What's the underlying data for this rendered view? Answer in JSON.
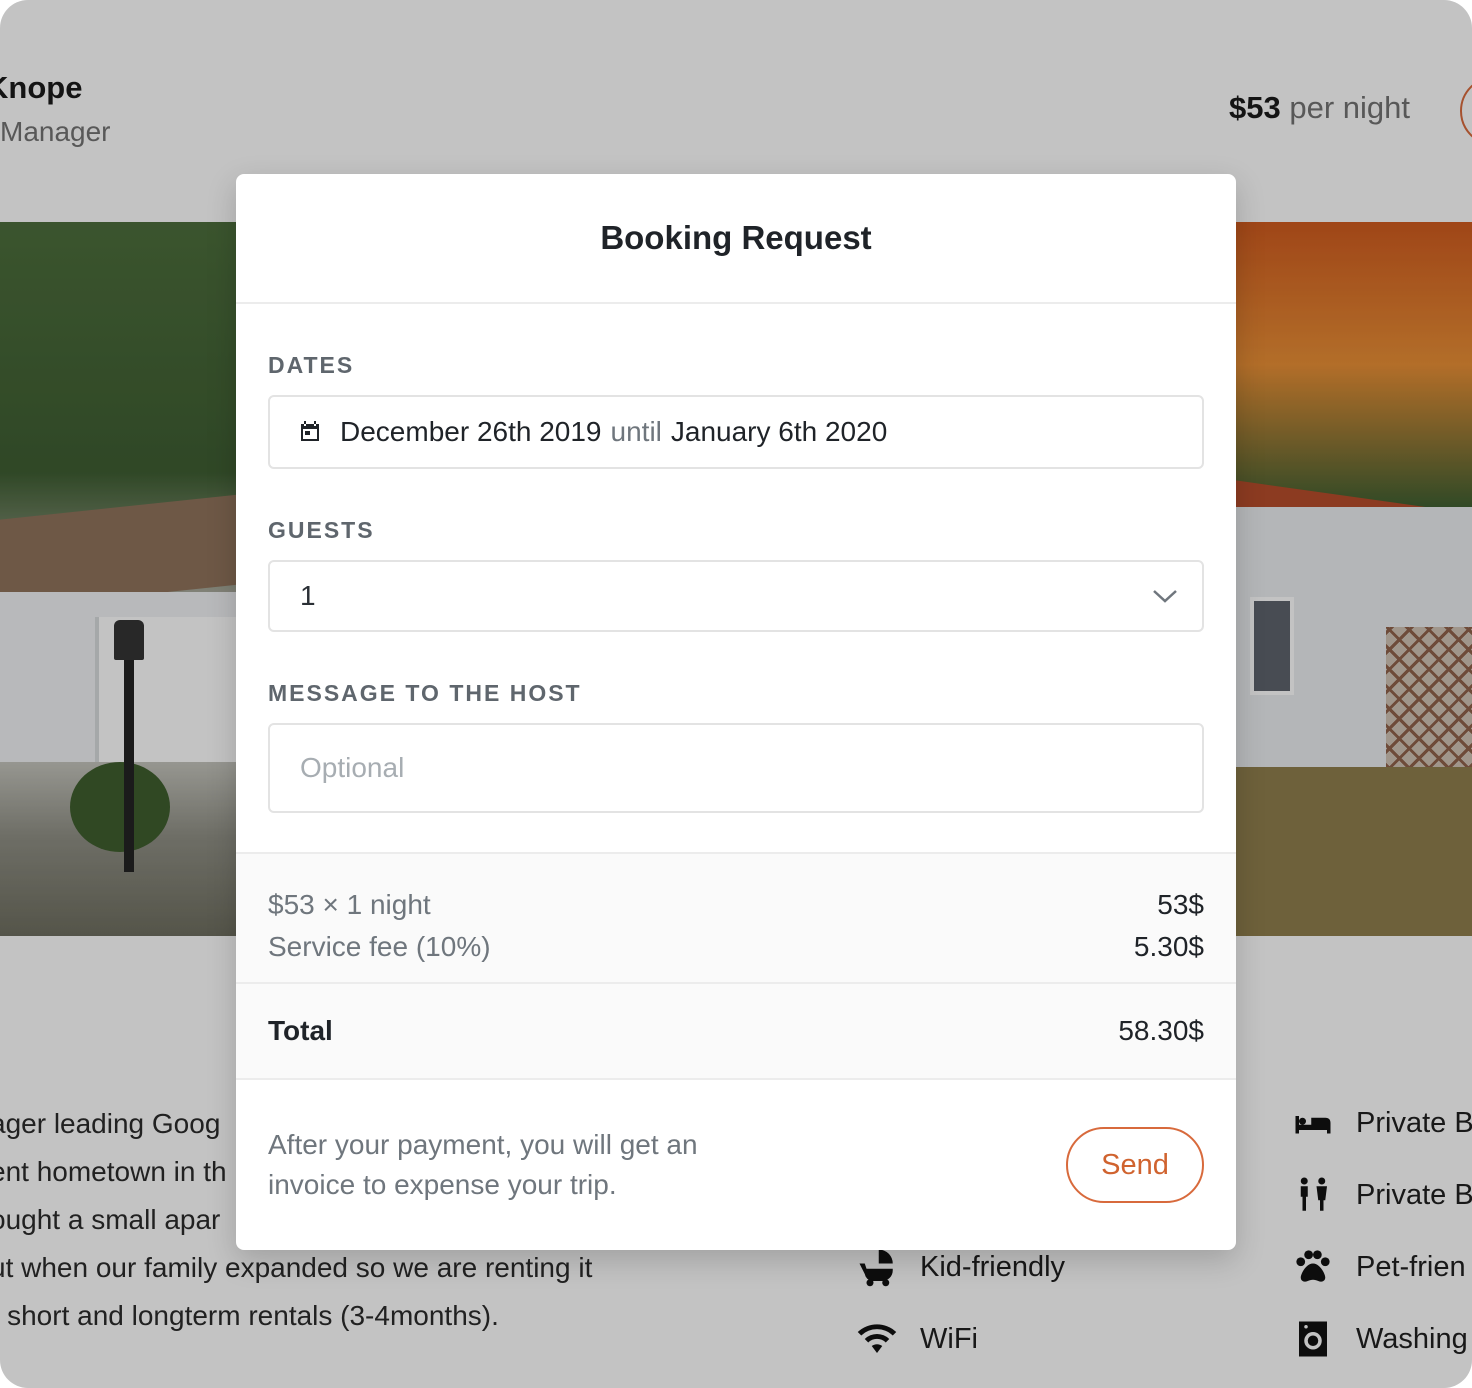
{
  "background": {
    "host_name": "Knope",
    "host_role": "Manager",
    "price_amount": "$53",
    "price_unit": "per night",
    "description_lines": [
      "ager leading Goog",
      "ent hometown in th",
      "ought a small apar",
      "ut when our family expanded so we are renting it",
      "r short and longterm rentals (3-4months)."
    ],
    "amenities": [
      {
        "label": "Private B",
        "icon": "bed-icon"
      },
      {
        "label": "Private B",
        "icon": "family-icon"
      },
      {
        "label": "Kid-friendly",
        "icon": "stroller-icon"
      },
      {
        "label": "Pet-frien",
        "icon": "paw-icon"
      },
      {
        "label": "WiFi",
        "icon": "wifi-icon"
      },
      {
        "label": "Washing",
        "icon": "washing-machine-icon"
      }
    ]
  },
  "modal": {
    "title": "Booking Request",
    "dates": {
      "label": "DATES",
      "start": "December 26th 2019",
      "connector": "until",
      "end": "January 6th 2020"
    },
    "guests": {
      "label": "GUESTS",
      "value": "1"
    },
    "message": {
      "label": "MESSAGE TO THE HOST",
      "placeholder": "Optional",
      "value": ""
    },
    "breakdown": [
      {
        "label": "$53 × 1 night",
        "value": "53$"
      },
      {
        "label": "Service fee (10%)",
        "value": "5.30$"
      }
    ],
    "total": {
      "label": "Total",
      "value": "58.30$"
    },
    "footer_note": "After your payment, you will get an invoice to expense your trip.",
    "send_label": "Send"
  },
  "colors": {
    "accent": "#d0632f",
    "overlay": "rgba(0,0,0,0.2)",
    "label": "#5f666d"
  }
}
